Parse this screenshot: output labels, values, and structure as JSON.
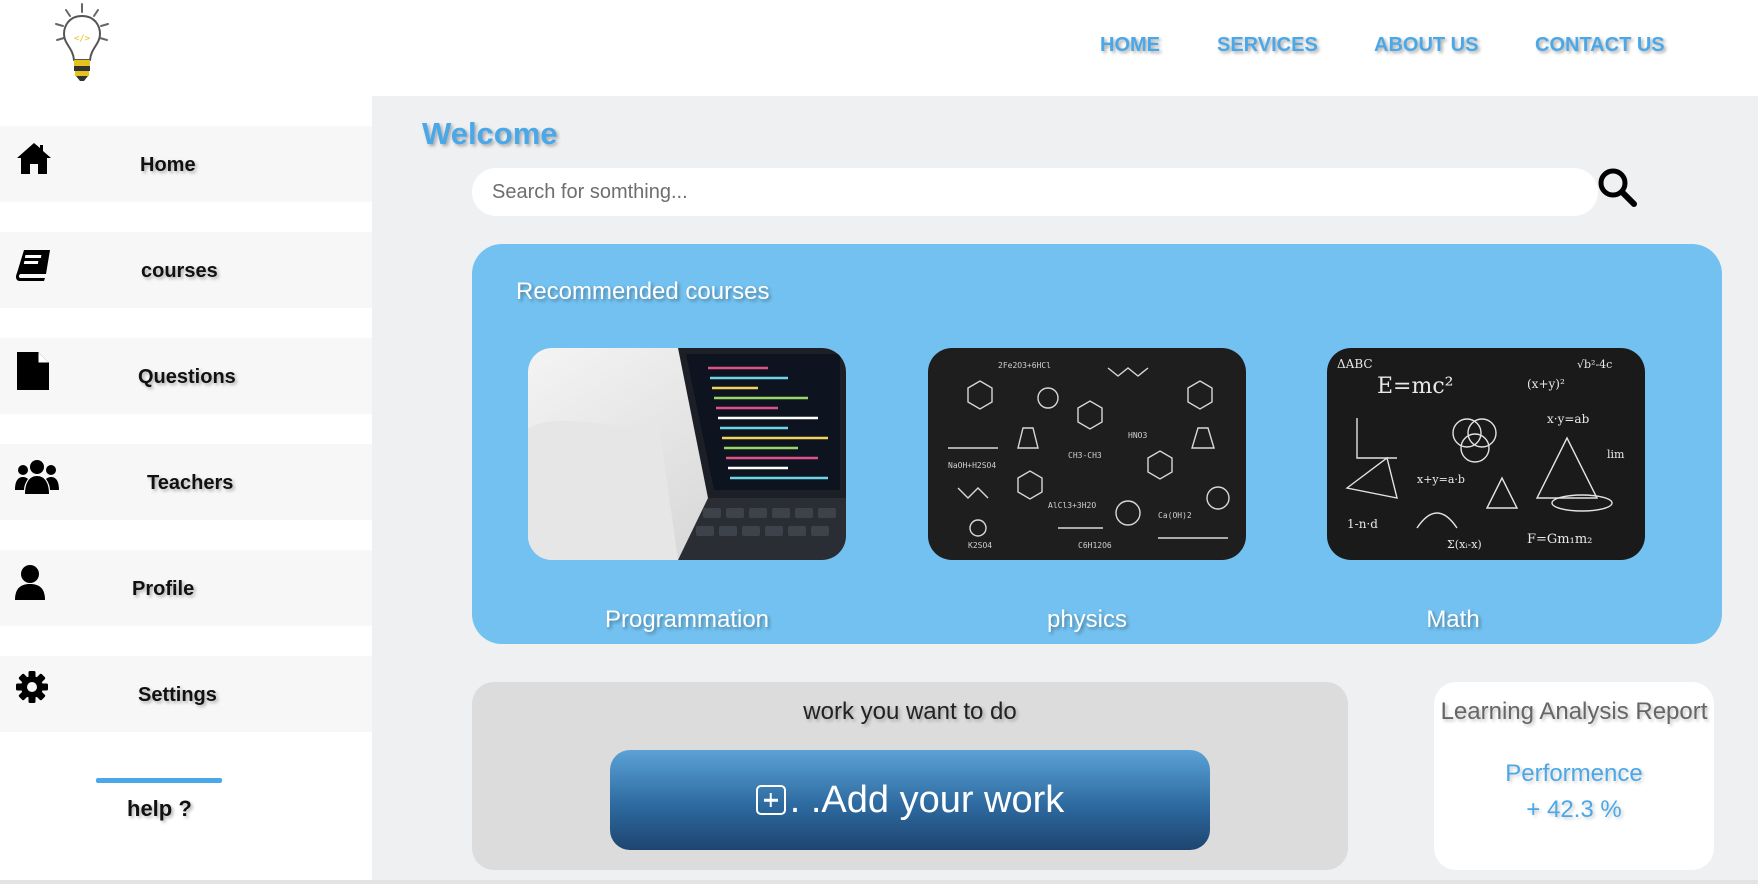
{
  "nav": [
    "HOME",
    "SERVICES",
    "ABOUT US",
    "CONTACT US"
  ],
  "sidebar": {
    "items": [
      {
        "label": "Home",
        "icon": "home-icon"
      },
      {
        "label": "courses",
        "icon": "book-icon"
      },
      {
        "label": "Questions",
        "icon": "file-icon"
      },
      {
        "label": "Teachers",
        "icon": "users-icon"
      },
      {
        "label": "Profile",
        "icon": "user-icon"
      },
      {
        "label": "Settings",
        "icon": "gear-icon"
      }
    ],
    "help": "help ?"
  },
  "main": {
    "welcome": "Welcome",
    "search_placeholder": "Search for somthing...",
    "recommended": {
      "title": "Recommended courses",
      "courses": [
        {
          "label": "Programmation"
        },
        {
          "label": "physics"
        },
        {
          "label": "Math"
        }
      ]
    },
    "work": {
      "title": "work you want to do",
      "button": ". .Add your work"
    },
    "report": {
      "title": "Learning Analysis Report",
      "metric_label": "Performence",
      "metric_value": "+ 42.3 %"
    }
  },
  "colors": {
    "accent": "#4aa8e8",
    "recommended_bg": "#72c1f0",
    "main_bg": "#eff0f2",
    "button_top": "#5ba2d6",
    "button_bottom": "#1e4570"
  }
}
